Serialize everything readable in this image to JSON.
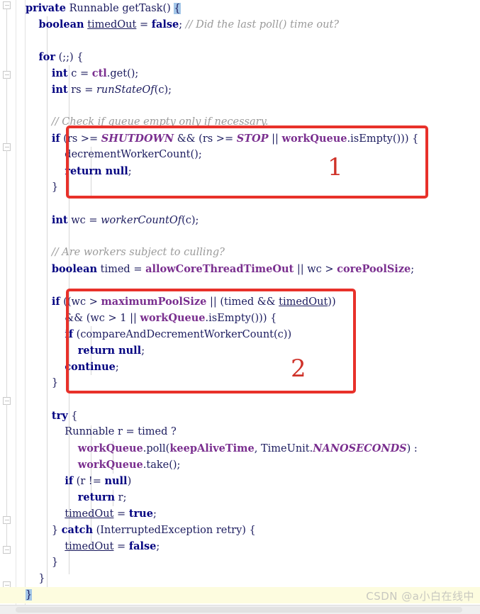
{
  "app": {
    "type": "code-editor",
    "language": "Java",
    "theme": "light"
  },
  "colors": {
    "keyword": "#000080",
    "comment": "#9a9a9a",
    "field": "#7a2f8f",
    "static_field": "#7a2f8f",
    "plain": "#1b1b5e",
    "annotation_red": "#e8312a",
    "annotation_number": "#cf3229",
    "current_line_bg": "#fdfcdf",
    "brace_match_bg": "#a3c6e8",
    "indent_guide": "#d6d6d6",
    "watermark": "#c8c8c0"
  },
  "code": {
    "lines": [
      {
        "indent": 0,
        "text": "private Runnable getTask() {"
      },
      {
        "indent": 1,
        "text": "boolean timedOut = false; // Did the last poll() time out?"
      },
      {
        "indent": 0,
        "text": ""
      },
      {
        "indent": 1,
        "text": "for (;;) {"
      },
      {
        "indent": 2,
        "text": "int c = ctl.get();"
      },
      {
        "indent": 2,
        "text": "int rs = runStateOf(c);"
      },
      {
        "indent": 0,
        "text": ""
      },
      {
        "indent": 2,
        "text": "// Check if queue empty only if necessary."
      },
      {
        "indent": 2,
        "text": "if (rs >= SHUTDOWN && (rs >= STOP || workQueue.isEmpty())) {"
      },
      {
        "indent": 3,
        "text": "decrementWorkerCount();"
      },
      {
        "indent": 3,
        "text": "return null;"
      },
      {
        "indent": 2,
        "text": "}"
      },
      {
        "indent": 0,
        "text": ""
      },
      {
        "indent": 2,
        "text": "int wc = workerCountOf(c);"
      },
      {
        "indent": 0,
        "text": ""
      },
      {
        "indent": 2,
        "text": "// Are workers subject to culling?"
      },
      {
        "indent": 2,
        "text": "boolean timed = allowCoreThreadTimeOut || wc > corePoolSize;"
      },
      {
        "indent": 0,
        "text": ""
      },
      {
        "indent": 2,
        "text": "if ((wc > maximumPoolSize || (timed && timedOut))"
      },
      {
        "indent": 3,
        "text": "&& (wc > 1 || workQueue.isEmpty())) {"
      },
      {
        "indent": 3,
        "text": "if (compareAndDecrementWorkerCount(c))"
      },
      {
        "indent": 4,
        "text": "return null;"
      },
      {
        "indent": 3,
        "text": "continue;"
      },
      {
        "indent": 2,
        "text": "}"
      },
      {
        "indent": 0,
        "text": ""
      },
      {
        "indent": 2,
        "text": "try {"
      },
      {
        "indent": 3,
        "text": "Runnable r = timed ?"
      },
      {
        "indent": 4,
        "text": "workQueue.poll(keepAliveTime, TimeUnit.NANOSECONDS) :"
      },
      {
        "indent": 4,
        "text": "workQueue.take();"
      },
      {
        "indent": 3,
        "text": "if (r != null)"
      },
      {
        "indent": 4,
        "text": "return r;"
      },
      {
        "indent": 3,
        "text": "timedOut = true;"
      },
      {
        "indent": 2,
        "text": "} catch (InterruptedException retry) {"
      },
      {
        "indent": 3,
        "text": "timedOut = false;"
      },
      {
        "indent": 2,
        "text": "}"
      },
      {
        "indent": 1,
        "text": "}"
      },
      {
        "indent": 0,
        "text": "}"
      }
    ]
  },
  "annotations": [
    {
      "label": "1",
      "target": "shutdown-state-check-block"
    },
    {
      "label": "2",
      "target": "worker-count-timeout-block"
    }
  ],
  "watermark": {
    "text": "CSDN @a小白在线中"
  },
  "scrollbar": {
    "orientation": "horizontal",
    "position": "bottom"
  }
}
